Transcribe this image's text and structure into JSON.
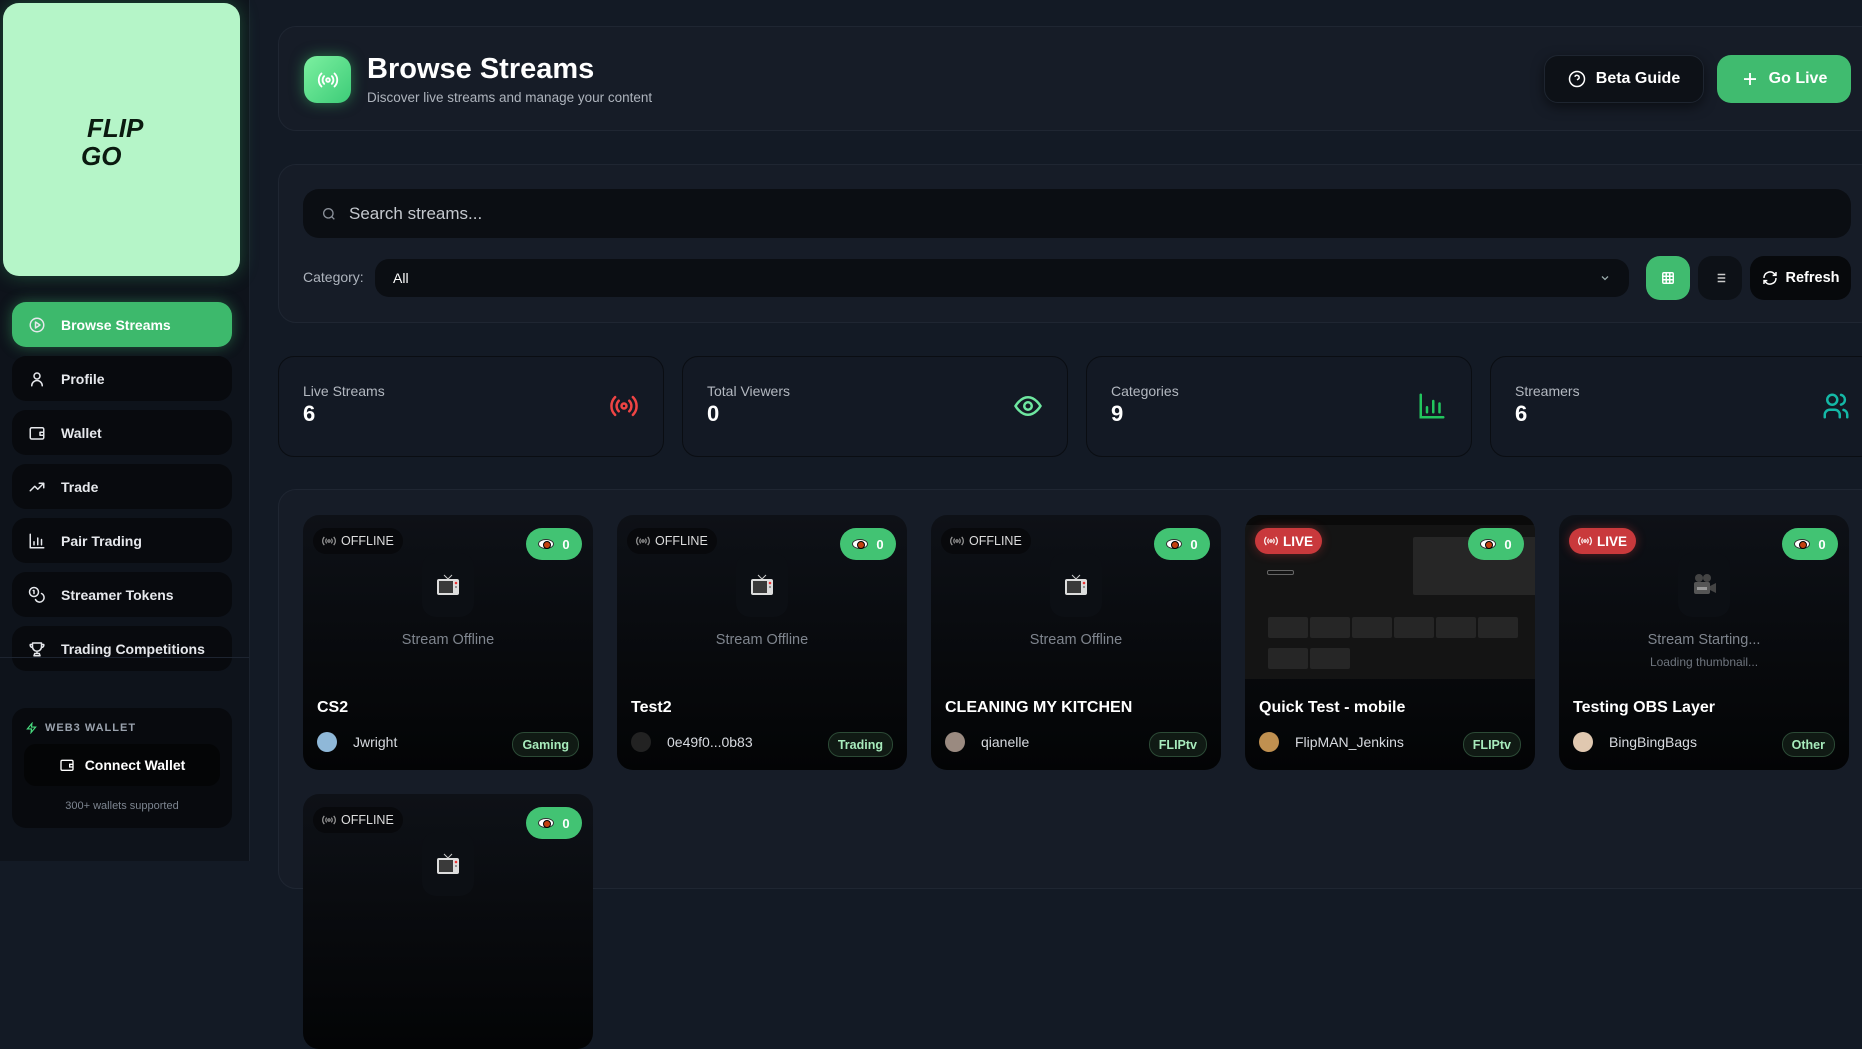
{
  "brand": {
    "logo_text": "FLIP GO"
  },
  "sidebar": {
    "items": [
      {
        "label": "Browse Streams",
        "icon": "play-circle-icon",
        "active": true
      },
      {
        "label": "Profile",
        "icon": "user-icon"
      },
      {
        "label": "Wallet",
        "icon": "wallet-icon"
      },
      {
        "label": "Trade",
        "icon": "trending-up-icon"
      },
      {
        "label": "Pair Trading",
        "icon": "bar-chart-icon"
      },
      {
        "label": "Streamer Tokens",
        "icon": "coins-icon"
      },
      {
        "label": "Trading Competitions",
        "icon": "trophy-icon"
      }
    ],
    "wallet": {
      "title": "WEB3 WALLET",
      "button": "Connect Wallet",
      "note": "300+ wallets supported"
    }
  },
  "header": {
    "title": "Browse Streams",
    "subtitle": "Discover live streams and manage your content",
    "beta_label": "Beta Guide",
    "golive_label": "Go Live"
  },
  "filters": {
    "search_placeholder": "Search streams...",
    "search_value": "",
    "category_label": "Category:",
    "category_value": "All",
    "refresh_label": "Refresh",
    "view_mode": "grid"
  },
  "stats": [
    {
      "label": "Live Streams",
      "value": "6",
      "icon": "broadcast-icon",
      "color": "#ef4444"
    },
    {
      "label": "Total Viewers",
      "value": "0",
      "icon": "eye-icon",
      "color": "#6ee7a0"
    },
    {
      "label": "Categories",
      "value": "9",
      "icon": "bar-chart-icon",
      "color": "#22c55e"
    },
    {
      "label": "Streamers",
      "value": "6",
      "icon": "users-icon",
      "color": "#14b8a6"
    }
  ],
  "streams": [
    {
      "title": "CS2",
      "author": "Jwright",
      "category": "Gaming",
      "status": "OFFLINE",
      "viewers": "0",
      "placeholder": "Stream Offline",
      "thumb": "tv"
    },
    {
      "title": "Test2",
      "author": "0e49f0...0b83",
      "category": "Trading",
      "status": "OFFLINE",
      "viewers": "0",
      "placeholder": "Stream Offline",
      "thumb": "tv"
    },
    {
      "title": "CLEANING MY KITCHEN",
      "author": "qianelle",
      "category": "FLIPtv",
      "status": "OFFLINE",
      "viewers": "0",
      "placeholder": "Stream Offline",
      "thumb": "tv"
    },
    {
      "title": "Quick Test - mobile",
      "author": "FlipMAN_Jenkins",
      "category": "FLIPtv",
      "status": "LIVE",
      "viewers": "0",
      "thumb": "screenshot"
    },
    {
      "title": "Testing OBS Layer",
      "author": "BingBingBags",
      "category": "Other",
      "status": "LIVE",
      "viewers": "0",
      "placeholder": "Stream Starting...",
      "placeholder_sub": "Loading thumbnail...",
      "thumb": "camera"
    },
    {
      "status": "OFFLINE",
      "viewers": "0",
      "thumb": "tv"
    }
  ],
  "colors": {
    "accent": "#40bb6f",
    "live": "#c9393c",
    "logo_bg": "#b5f5c8"
  }
}
